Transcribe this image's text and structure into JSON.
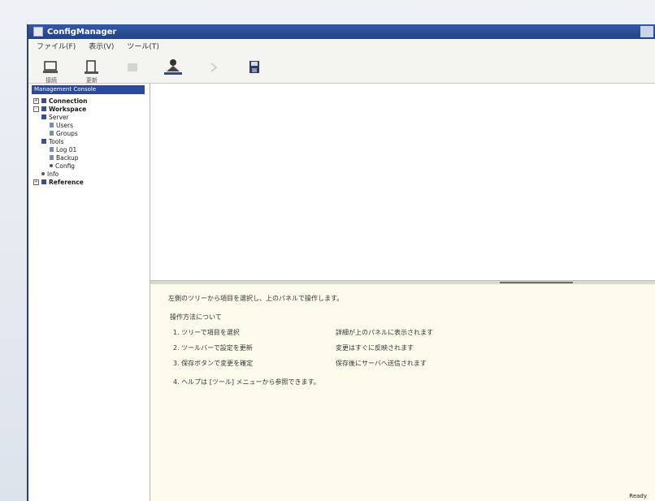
{
  "window": {
    "title": "ConfigManager"
  },
  "menu": {
    "items": [
      "ファイル(F)",
      "表示(V)",
      "ツール(T)"
    ]
  },
  "toolbar": {
    "tools": [
      {
        "label": "接続",
        "icon": "connect-icon",
        "enabled": true
      },
      {
        "label": "更新",
        "icon": "refresh-icon",
        "enabled": true
      },
      {
        "label": "",
        "icon": "stop-icon",
        "enabled": false
      },
      {
        "label": "",
        "icon": "user-upload-icon",
        "enabled": true
      },
      {
        "label": "",
        "icon": "help-icon",
        "enabled": false
      },
      {
        "label": "",
        "icon": "save-icon",
        "enabled": true
      }
    ]
  },
  "tree": {
    "header": "Management Console",
    "items": [
      {
        "label": "Connection",
        "depth": 0,
        "type": "node-collapsed",
        "bold": true
      },
      {
        "label": "Workspace",
        "depth": 0,
        "type": "node-expanded",
        "bold": true
      },
      {
        "label": "Server",
        "depth": 1,
        "type": "folder"
      },
      {
        "label": "Users",
        "depth": 2,
        "type": "leaf"
      },
      {
        "label": "Groups",
        "depth": 2,
        "type": "leaf"
      },
      {
        "label": "Tools",
        "depth": 1,
        "type": "folder"
      },
      {
        "label": "Log 01",
        "depth": 2,
        "type": "leaf"
      },
      {
        "label": "Backup",
        "depth": 2,
        "type": "leaf"
      },
      {
        "label": "Config",
        "depth": 2,
        "type": "dot"
      },
      {
        "label": "Info",
        "depth": 1,
        "type": "dot"
      },
      {
        "label": "Reference",
        "depth": 0,
        "type": "node-collapsed",
        "bold": true
      }
    ]
  },
  "info": {
    "title": "左側のツリーから項目を選択し、上のパネルで操作します。",
    "subtitle": "操作方法について",
    "rows": [
      {
        "left": "1. ツリーで項目を選択",
        "right": "詳細が上のパネルに表示されます"
      },
      {
        "left": "2. ツールバーで設定を更新",
        "right": "変更はすぐに反映されます"
      },
      {
        "left": "3. 保存ボタンで変更を確定",
        "right": "保存後にサーバへ送信されます"
      }
    ],
    "footer": "4. ヘルプは [ツール] メニューから参照できます。"
  },
  "status": {
    "text": "Ready"
  }
}
